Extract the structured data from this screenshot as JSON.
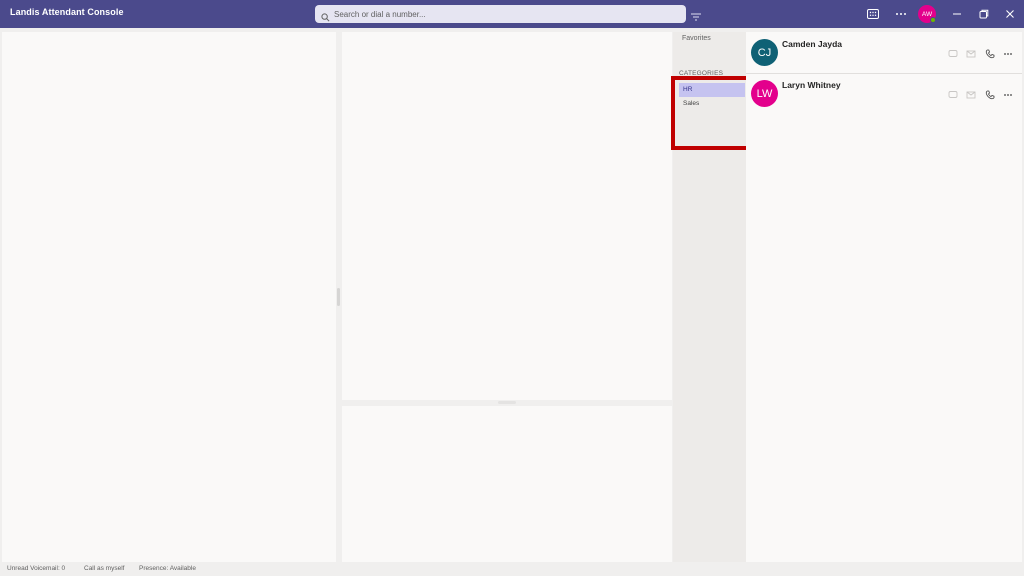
{
  "app": {
    "title": "Landis Attendant Console"
  },
  "search": {
    "placeholder": "Search or dial a number..."
  },
  "user": {
    "initials": "AW",
    "presence_color": "#6bb700",
    "avatar_color": "#e3008c"
  },
  "icons": {
    "search": "search-icon",
    "filter": "filter-icon",
    "dialpad": "dialpad-icon",
    "more": "more-icon",
    "minimize": "minimize-icon",
    "restore": "restore-icon",
    "close": "close-icon"
  },
  "nav": {
    "favorites": "Favorites",
    "categories_header": "CATEGORIES",
    "categories": [
      {
        "label": "HR",
        "selected": true
      },
      {
        "label": "Sales",
        "selected": false
      }
    ]
  },
  "contacts": [
    {
      "initials": "CJ",
      "name": "Camden Jayda",
      "avatar_color": "#0f6175"
    },
    {
      "initials": "LW",
      "name": "Laryn Whitney",
      "avatar_color": "#e3008c"
    }
  ],
  "status": {
    "voicemail": "Unread Voicemail: 0",
    "call_as": "Call as myself",
    "presence": "Presence: Available"
  },
  "colors": {
    "titlebar": "#4b4a8c",
    "highlight": "#c00000",
    "selected_category": "#c5c3f0"
  }
}
